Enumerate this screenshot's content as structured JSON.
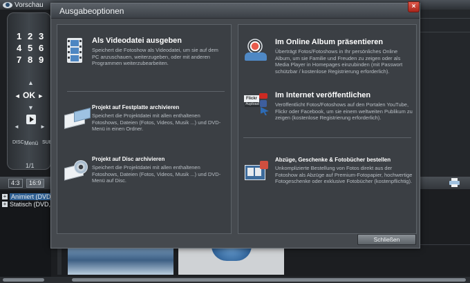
{
  "app": {
    "preview_label": "Vorschau",
    "remote": {
      "digits": [
        "1",
        "2",
        "3",
        "4",
        "5",
        "6",
        "7",
        "8",
        "9"
      ],
      "ok_label": "OK",
      "left_arrow": "◄",
      "right_arrow": "►",
      "up_arrow": "▲",
      "down_arrow": "▼",
      "disc_label": "DISC",
      "menu_label": "Menü",
      "sub_label": "SUB",
      "page_indicator": "1/1"
    },
    "aspect_ratios": [
      "4:3",
      "16:9"
    ],
    "tree_items": [
      {
        "label": "Animiert (DVD)",
        "selected": true
      },
      {
        "label": "Statisch (DVD, VC",
        "selected": false
      }
    ]
  },
  "dialog": {
    "title": "Ausgabeoptionen",
    "close_x": "×",
    "left_options": [
      {
        "icon": "film-strip-icon",
        "title": "Als Videodatei ausgeben",
        "description": "Speichert die Fotoshow als Videodatei, um sie auf dem PC anzuschauen, weiterzugeben, oder mit anderen Programmen weiterzubearbeiten."
      },
      {
        "icon": "archive-box-icon",
        "title": "Projekt auf Festplatte archivieren",
        "description": "Speichert die Projektdatei mit allen enthaltenen Fotoshows, Dateien (Fotos, Videos, Musik ...) und DVD-Menü in einen Ordner."
      },
      {
        "icon": "disc-archive-icon",
        "title": "Projekt auf Disc archivieren",
        "description": "Speichert die Projektdatei  mit allen enthaltenen Fotoshows, Dateien (Fotos, Videos, Musik ...) und DVD-Menü auf Disc."
      }
    ],
    "right_options": [
      {
        "icon": "online-album-icon",
        "title": "Im Online Album präsentieren",
        "description": "Überträgt Fotos/Fotoshows in Ihr persönliches Online Album, um sie Familie und Freuden zu zeigen oder als Media Player in Homepages einzubinden (mit Passwort schützbar / kostenlose Registrierung erforderlich)."
      },
      {
        "icon": "internet-publish-icon",
        "title": "Im Internet veröffentlichen",
        "description": "Veröffentlicht Fotos/Fotoshows auf den Portalen YouTube, Flickr oder Facebook, um sie einem weltweiten Publikum zu zeigen (kostenlose Registrierung erforderlich).",
        "badge_flickr": "Flickr",
        "badge_upload": "#upload"
      },
      {
        "icon": "prints-gifts-icon",
        "title": "Abzüge, Geschenke & Fotobücher bestellen",
        "description": "Unkomplizierte Bestellung von Fotos direkt aus der Fotoshow als Abzüge auf Premium-Fotopapier, hochwertige Fotogeschenke oder exklusive Fotobücher (kostenpflichtig)."
      }
    ],
    "close_label": "Schließen"
  },
  "colors": {
    "accent_selection": "#2f5f92",
    "close_button_red": "#c8362b",
    "dialog_bg": "#45494e"
  }
}
